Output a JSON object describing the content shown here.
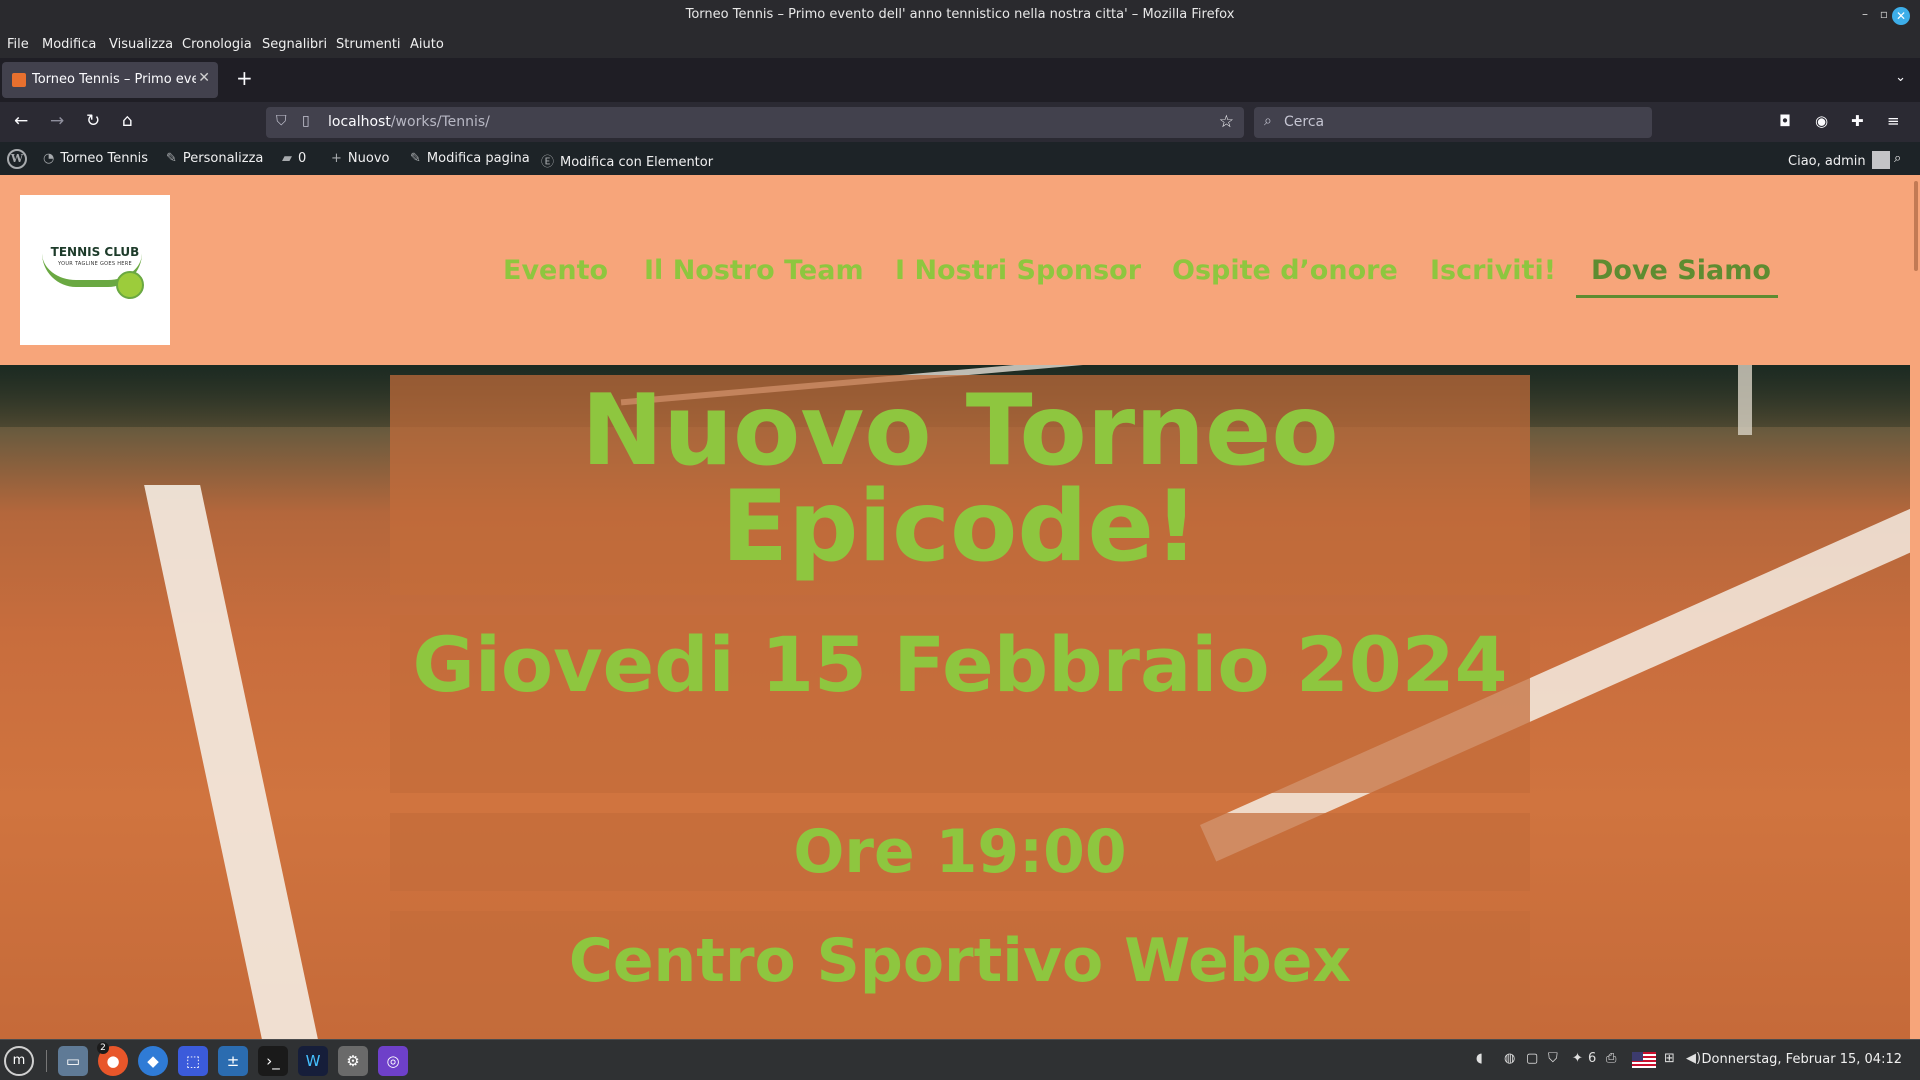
{
  "window": {
    "title": "Torneo Tennis – Primo evento dell' anno tennistico nella nostra citta' – Mozilla Firefox",
    "controls": {
      "minimize": "–",
      "maximize": "▫",
      "close": "✕"
    }
  },
  "menubar": [
    "File",
    "Modifica",
    "Visualizza",
    "Cronologia",
    "Segnalibri",
    "Strumenti",
    "Aiuto"
  ],
  "tabs": {
    "active_label": "Torneo Tennis – Primo evento dell' anno tennistico",
    "close": "✕",
    "new_tab": "+",
    "list": "⌄"
  },
  "nav": {
    "back": "←",
    "forward": "→",
    "reload": "↻",
    "home": "⌂",
    "url_host": "localhost",
    "url_path": "/works/Tennis/",
    "star": "☆",
    "search_placeholder": "Cerca"
  },
  "wp_admin": {
    "logo": "W",
    "site_name": "Torneo Tennis",
    "customize": "Personalizza",
    "comments_count": "0",
    "new": "Nuovo",
    "edit_page": "Modifica pagina",
    "edit_elementor": "Modifica con Elementor",
    "greeting": "Ciao, admin"
  },
  "site": {
    "logo_title": "TENNIS CLUB",
    "logo_tagline": "YOUR TAGLINE GOES HERE",
    "nav": [
      "Evento",
      "Il Nostro Team",
      "I Nostri Sponsor",
      "Ospite d’onore",
      "Iscriviti!",
      "Dove Siamo"
    ],
    "active_nav": "Dove Siamo",
    "hero": {
      "title": "Nuovo Torneo Epicode!",
      "date": "Giovedi 15 Febbraio 2024",
      "time": "Ore 19:00",
      "venue": "Centro Sportivo Webex"
    }
  },
  "taskbar": {
    "firefox_badge": "2",
    "tray_count": "6",
    "clock": "Donnerstag, Februar 15, 04:12"
  },
  "colors": {
    "header_bg": "#f7a57a",
    "nav_text": "#8ec63f",
    "nav_active": "#5e8c31",
    "hero_text": "#8ec63f",
    "wp_bar": "#1d2327"
  }
}
